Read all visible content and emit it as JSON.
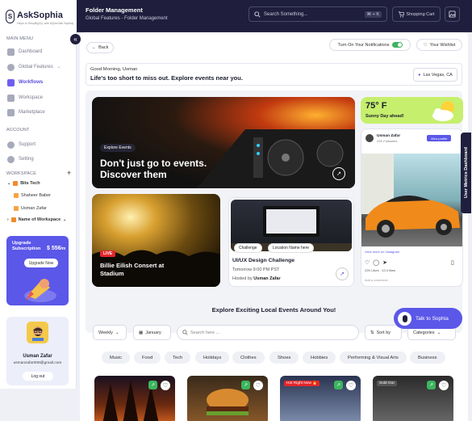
{
  "app": {
    "name": "AskSophia",
    "tagline": "Helps to Simplify(AI), with AI(Not Ask Sophia)"
  },
  "header": {
    "title": "Folder Management",
    "breadcrumb": "Global Features - Folder Management",
    "search_placeholder": "Search Something...",
    "shortcut": "⌘ + K",
    "cart_label": "Shopping Cart"
  },
  "sidebar": {
    "main_menu_label": "MAIN MENU",
    "items": [
      {
        "label": "Dashboard"
      },
      {
        "label": "Global Features"
      },
      {
        "label": "Workflows"
      },
      {
        "label": "Workspace"
      },
      {
        "label": "Marketplace"
      }
    ],
    "account_label": "ACCOUNT",
    "account_items": [
      {
        "label": "Support"
      },
      {
        "label": "Setting"
      }
    ],
    "workspace_label": "WORKSPACE",
    "workspaces": [
      {
        "label": "Bits Tech"
      },
      {
        "label": "Shaheer Baber"
      },
      {
        "label": "Usman Zafar"
      },
      {
        "label": "Name of Workspace"
      }
    ],
    "promo": {
      "title": "Upgrade Subscription",
      "price": "$ 556",
      "per": "/m",
      "button": "Upgrade Now"
    },
    "profile": {
      "name": "Usman Zafar",
      "email": "usmanzafar009@gmail.com",
      "logout": "Log out"
    }
  },
  "toolbar": {
    "back": "Back",
    "notifications": "Turn On Your Notifications",
    "wishlist": "Your Wishlist"
  },
  "greeting": {
    "hello": "Good Morning, Usman",
    "tagline": "Life's too short to miss out. Explore events near you.",
    "location": "Las Vegas, CA"
  },
  "hero": {
    "badge": "Explore Events",
    "title": "Don't just go to events. Discover them"
  },
  "live_card": {
    "badge": "LIVE",
    "title": "Billie Eilish Consert at Stadium"
  },
  "challenge_card": {
    "tag1": "Challenge",
    "tag2": "Location Name here",
    "title": "UI/UX Design Challenge",
    "time": "Tomorrow 9:00 PM PST",
    "host_prefix": "Hosted by",
    "host": "Usman Zafar"
  },
  "weather": {
    "temp": "75° F",
    "desc": "Sunny Day ahead!"
  },
  "post": {
    "user": "Usman Zafar",
    "followers": "22K Followers",
    "view": "View profile",
    "link": "View more on Instagram",
    "likes": "22K",
    "likes_label": "Likes",
    "comments": "13.4 likes",
    "add_comment": "Add a comment..."
  },
  "side_tab": "User Metrics Dashboard",
  "explore": {
    "title": "Explore Exciting Local Events Around You!",
    "period": "Weekly",
    "month": "January",
    "search_placeholder": "Search here ...",
    "sort": "Sort by",
    "categories_label": "Categories",
    "chips": [
      "Music",
      "Food",
      "Tech",
      "Holidays",
      "Clothes",
      "Shoes",
      "Hobbies",
      "Performing & Visual Arts",
      "Business"
    ],
    "events": [
      {
        "tag": ""
      },
      {
        "tag": ""
      },
      {
        "tag": "Hot Right Now 🔥"
      },
      {
        "tag": "Sold Out"
      }
    ]
  },
  "talk": "Talk to Sophia",
  "colors": {
    "accent": "#5b57e8",
    "nav_dark": "#1f1f3d",
    "weather": "#c6ef6d"
  }
}
